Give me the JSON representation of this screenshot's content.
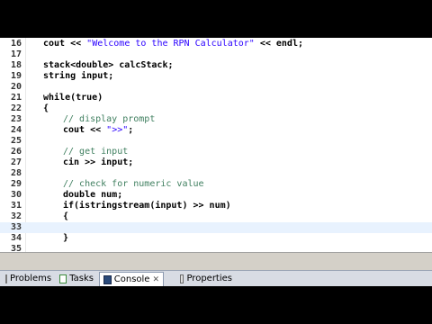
{
  "editor": {
    "lines": [
      {
        "n": "16",
        "text": "cout << ",
        "str": "\"Welcome to the RPN Calculator\"",
        "rest": " << endl;",
        "indent": 0
      },
      {
        "n": "17",
        "text": "",
        "indent": 0
      },
      {
        "n": "18",
        "text": "stack<double> calcStack;",
        "indent": 0
      },
      {
        "n": "19",
        "text": "string input;",
        "indent": 0
      },
      {
        "n": "20",
        "text": "",
        "indent": 0
      },
      {
        "n": "21",
        "text": "while(true)",
        "indent": 0
      },
      {
        "n": "22",
        "text": "{",
        "indent": 0
      },
      {
        "n": "23",
        "comment": "// display prompt",
        "indent": 1
      },
      {
        "n": "24",
        "text": "cout << ",
        "str": "\">>\"",
        "rest": ";",
        "indent": 1
      },
      {
        "n": "25",
        "text": "",
        "indent": 1
      },
      {
        "n": "26",
        "comment": "// get input",
        "indent": 1
      },
      {
        "n": "27",
        "text": "cin >> input;",
        "indent": 1
      },
      {
        "n": "28",
        "text": "",
        "indent": 1
      },
      {
        "n": "29",
        "comment": "// check for numeric value",
        "indent": 1
      },
      {
        "n": "30",
        "text": "double num;",
        "indent": 1
      },
      {
        "n": "31",
        "text": "if(istringstream(input) >> num)",
        "indent": 1
      },
      {
        "n": "32",
        "text": "{",
        "indent": 1
      },
      {
        "n": "33",
        "text": "",
        "indent": 1,
        "current": true
      },
      {
        "n": "34",
        "text": "}",
        "indent": 1
      },
      {
        "n": "35",
        "text": "",
        "indent": 0
      }
    ]
  },
  "panel": {
    "tabs": [
      {
        "label": "Problems",
        "icon": "problems-icon",
        "active": false
      },
      {
        "label": "Tasks",
        "icon": "tasks-icon",
        "active": false
      },
      {
        "label": "Console",
        "icon": "console-icon",
        "active": true,
        "closable": true
      },
      {
        "label": "Properties",
        "icon": "properties-icon",
        "active": false
      }
    ],
    "close_glyph": "✕"
  }
}
